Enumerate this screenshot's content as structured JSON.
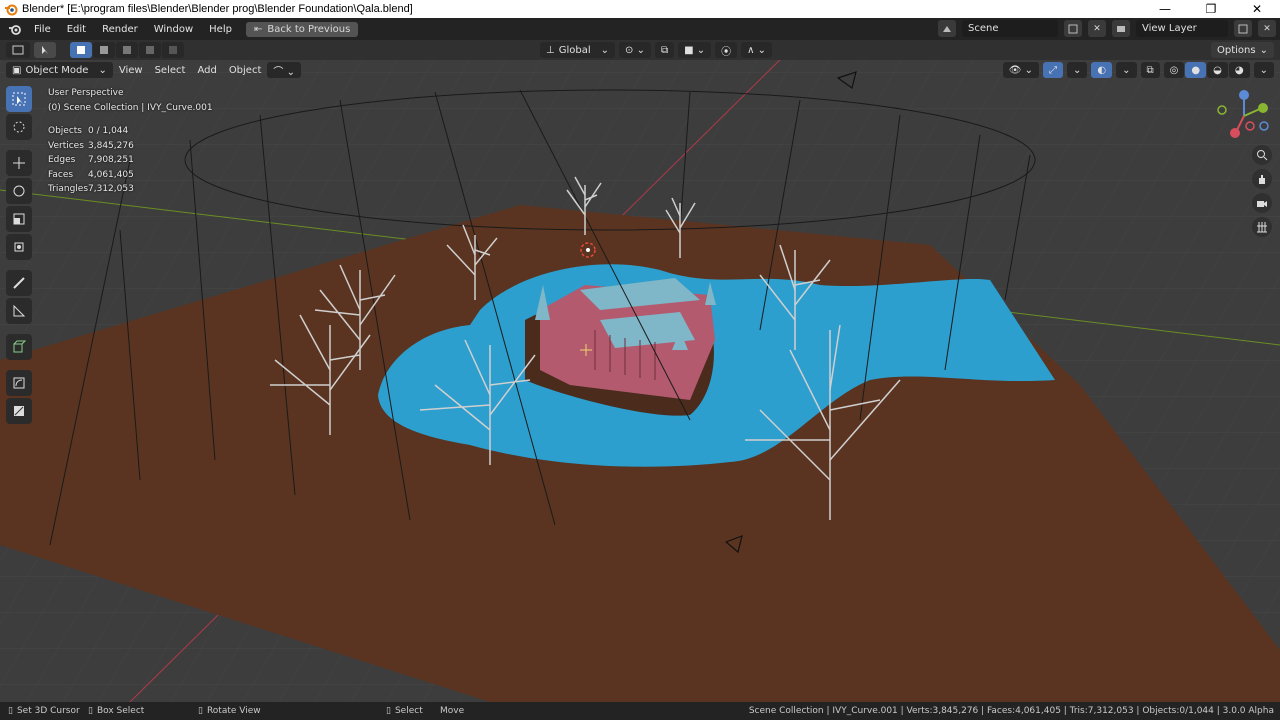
{
  "window": {
    "title": "Blender* [E:\\program files\\Blender\\Blender prog\\Blender Foundation\\Qala.blend]",
    "minimize": "—",
    "maximize": "❐",
    "close": "✕"
  },
  "menubar": {
    "items": [
      "File",
      "Edit",
      "Render",
      "Window",
      "Help"
    ],
    "back_button": "Back to Previous",
    "scene_label": "Scene",
    "view_layer_label": "View Layer"
  },
  "viewport_header": {
    "transform_orientation": "Global",
    "options_label": "Options",
    "mode_label": "Object Mode",
    "menus": [
      "View",
      "Select",
      "Add",
      "Object"
    ]
  },
  "viewport_overlay": {
    "perspective": "User Perspective",
    "collection": "(0) Scene Collection | IVY_Curve.001",
    "stats": [
      {
        "label": "Objects",
        "value": "0 / 1,044"
      },
      {
        "label": "Vertices",
        "value": "3,845,276"
      },
      {
        "label": "Edges",
        "value": "7,908,251"
      },
      {
        "label": "Faces",
        "value": "4,061,405"
      },
      {
        "label": "Triangles",
        "value": "7,312,053"
      }
    ]
  },
  "statusbar": {
    "hints": [
      "Set 3D Cursor",
      "Box Select",
      "Rotate View",
      "Select",
      "Move"
    ],
    "info": "Scene Collection | IVY_Curve.001 | Verts:3,845,276 | Faces:4,061,405 | Tris:7,312,053 | Objects:0/1,044 | 3.0.0 Alpha"
  },
  "colors": {
    "terrain": "#5a3420",
    "water": "#2c9fcf",
    "castle_wall": "#b35a6e",
    "roof": "#7fb6c8",
    "accent": "#4772b3",
    "grid_bg": "#3d3d3d"
  }
}
